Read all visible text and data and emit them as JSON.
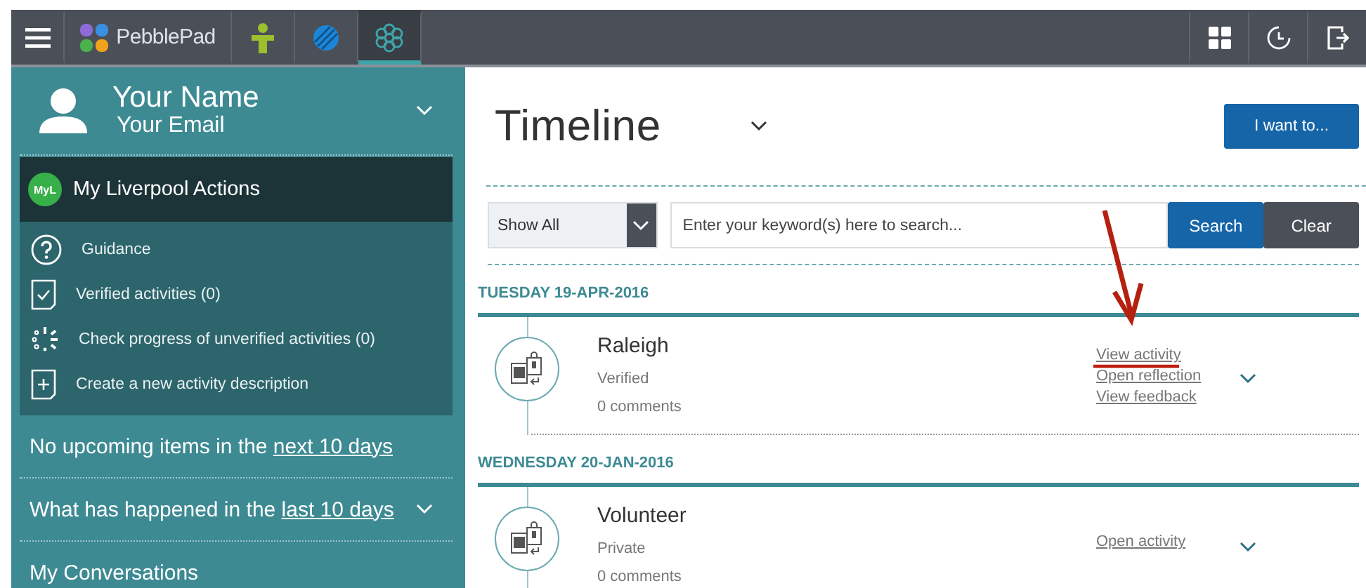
{
  "topbar": {
    "brand": "PebblePad",
    "tabs": [
      {
        "kind": "person",
        "selected": false
      },
      {
        "kind": "globe",
        "selected": false
      },
      {
        "kind": "flower",
        "selected": true
      }
    ],
    "actions": [
      {
        "kind": "grid"
      },
      {
        "kind": "clock"
      },
      {
        "kind": "logout"
      }
    ]
  },
  "sidebar": {
    "profile": {
      "name": "Your Name",
      "email": "Your Email"
    },
    "panel": {
      "title": "My Liverpool Actions",
      "badge": "MyL",
      "items": [
        {
          "kind": "help",
          "label": "Guidance"
        },
        {
          "kind": "check",
          "label": "Verified activities (0)"
        },
        {
          "kind": "progress",
          "label": "Check progress of unverified activities (0)"
        },
        {
          "kind": "add",
          "label": "Create a new activity description"
        }
      ]
    },
    "sections": [
      {
        "text": "No upcoming items in the",
        "link": "next 10 days",
        "expandable": false
      },
      {
        "text": "What has happened in the",
        "link": "last 10 days",
        "expandable": true
      },
      {
        "text": "My Conversations",
        "expandable": false
      }
    ]
  },
  "main": {
    "title": "Timeline",
    "action_button": "I want to...",
    "filter": {
      "value": "Show All",
      "placeholder": "Enter your keyword(s) here to search...",
      "buttons": [
        "Search",
        "Clear"
      ]
    },
    "days": [
      {
        "date": "TUESDAY 19-APR-2016",
        "items": [
          {
            "title": "Raleigh",
            "status": "Verified",
            "comments": "0 comments",
            "links": [
              "View activity",
              "Open reflection",
              "View feedback"
            ]
          }
        ]
      },
      {
        "date": "WEDNESDAY 20-JAN-2016",
        "items": [
          {
            "title": "Volunteer",
            "status": "Private",
            "comments": "0 comments",
            "links": [
              "Open activity"
            ]
          }
        ]
      }
    ]
  }
}
